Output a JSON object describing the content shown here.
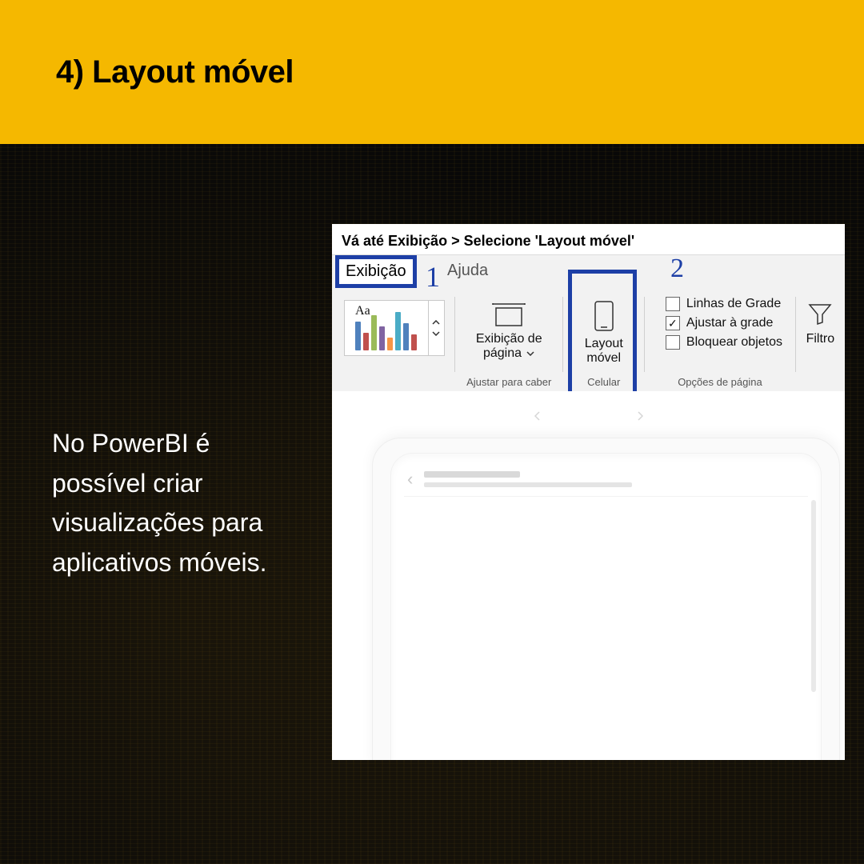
{
  "colors": {
    "accent_yellow": "#f5b800",
    "highlight_blue": "#1d3fa6"
  },
  "header": {
    "title": "4) Layout móvel"
  },
  "side_text": "No PowerBI é possível criar visualizações para aplicativos móveis.",
  "screenshot": {
    "instruction": "Vá até Exibição > Selecione 'Layout móvel'",
    "tabs": {
      "exibicao": "Exibição",
      "ajuda": "Ajuda"
    },
    "markers": {
      "one": "1",
      "two": "2"
    },
    "theme_sample_text": "Aa",
    "groups": {
      "page_view": {
        "button_line1": "Exibição de",
        "button_line2": "página",
        "label": "Ajustar para caber"
      },
      "mobile": {
        "button_line1": "Layout",
        "button_line2": "móvel",
        "label": "Celular"
      },
      "page_options": {
        "items": [
          {
            "label": "Linhas de Grade",
            "checked": false
          },
          {
            "label": "Ajustar à grade",
            "checked": true
          },
          {
            "label": "Bloquear objetos",
            "checked": false
          }
        ],
        "label": "Opções de página"
      },
      "filters": {
        "button": "Filtro"
      }
    },
    "theme_bar_colors": [
      "#4f81bd",
      "#c0504d",
      "#9bbb59",
      "#8064a2",
      "#f79646",
      "#4bacc6",
      "#4f81bd",
      "#c0504d"
    ],
    "theme_bar_heights": [
      36,
      22,
      44,
      30,
      16,
      48,
      34,
      20
    ]
  }
}
